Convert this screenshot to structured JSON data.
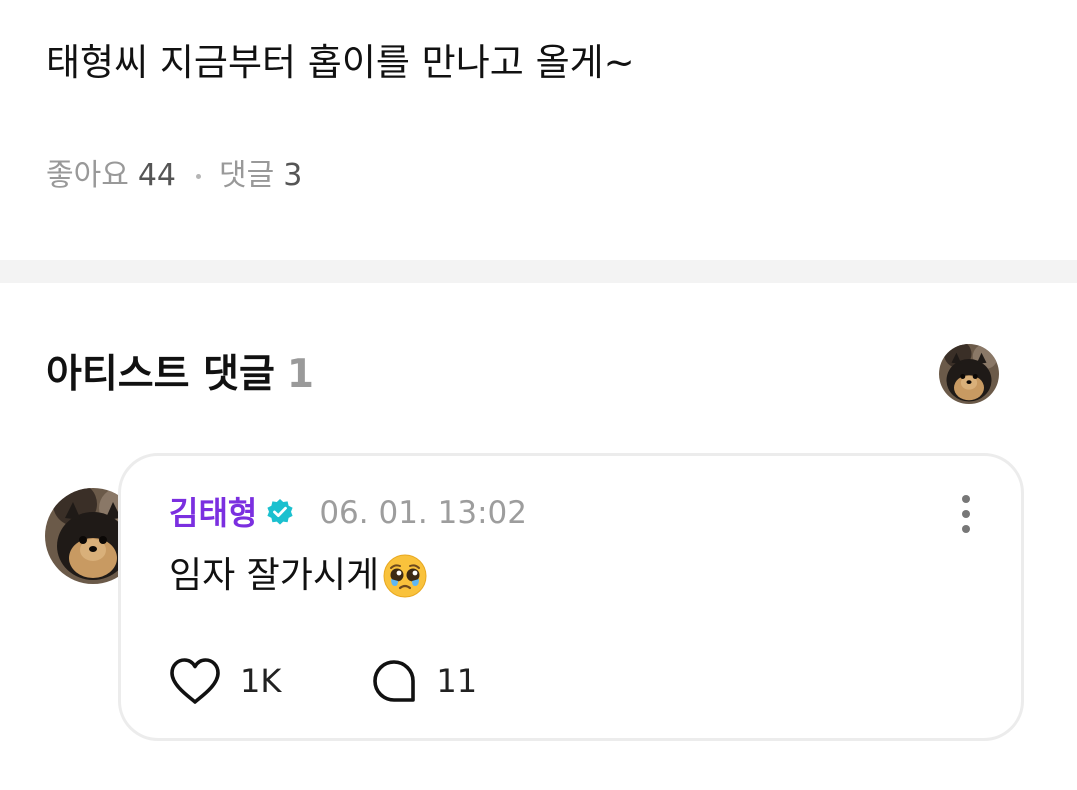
{
  "post": {
    "text": "태형씨 지금부터 홉이를 만나고 올게~",
    "likes_label": "좋아요",
    "likes_count": "44",
    "comments_label": "댓글",
    "comments_count": "3"
  },
  "artist_comments": {
    "title": "아티스트 댓글",
    "count": "1",
    "avatar_icon": "pomeranian-avatar"
  },
  "comment": {
    "author": "김태형",
    "verified_icon": "verified-badge-icon",
    "timestamp": "06. 01. 13:02",
    "text": "임자 잘가시게",
    "emoji": "pleading-face-with-tears-emoji",
    "likes": "1K",
    "replies": "11",
    "more_icon": "more-vertical-icon"
  },
  "colors": {
    "author": "#7b2fe0",
    "verified": "#1bc0cf",
    "muted_text": "#999999",
    "divider": "#f3f3f3",
    "card_border": "#ececec"
  }
}
